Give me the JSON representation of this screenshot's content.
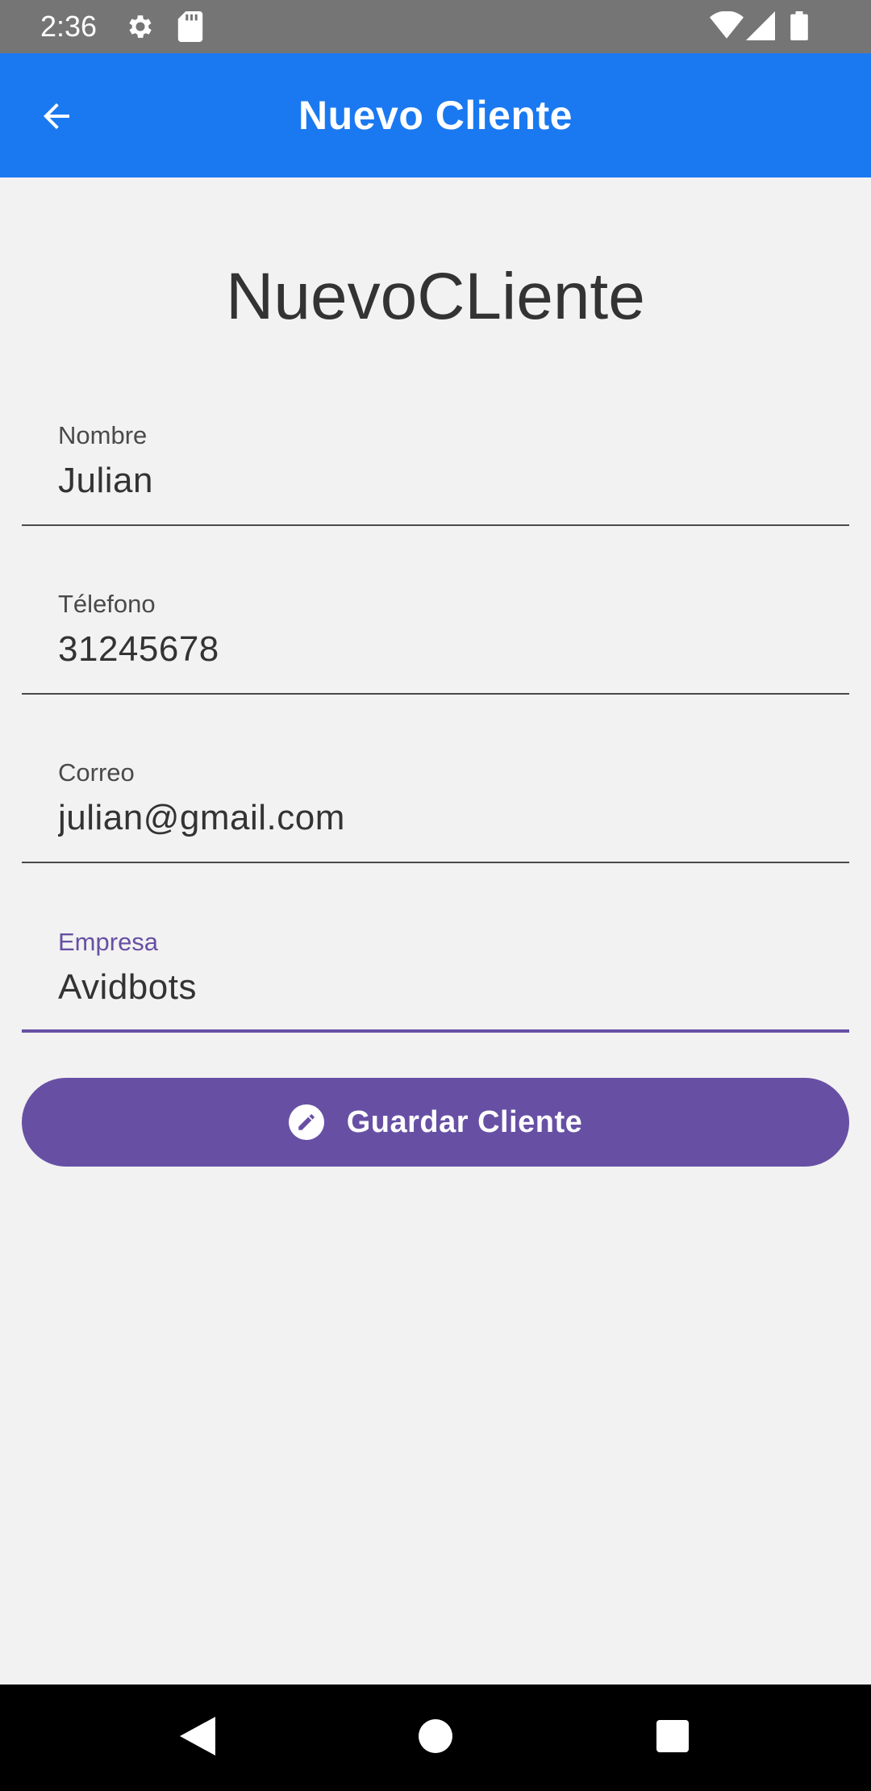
{
  "status_bar": {
    "time": "2:36",
    "icons": [
      "gear-icon",
      "sd-card-icon",
      "wifi-icon",
      "signal-icon",
      "battery-icon"
    ]
  },
  "app_bar": {
    "title": "Nuevo Cliente",
    "back_icon": "arrow-back-icon",
    "color": "#1a79f0"
  },
  "form": {
    "heading": "NuevoCLiente",
    "fields": [
      {
        "label": "Nombre",
        "value": "Julian"
      },
      {
        "label": "Télefono",
        "value": "31245678"
      },
      {
        "label": "Correo",
        "value": "julian@gmail.com"
      },
      {
        "label": "Empresa",
        "value": "Avidbots",
        "focused": true
      }
    ],
    "accent_color": "#6750a4"
  },
  "save_button": {
    "label": "Guardar Cliente",
    "icon": "edit-pencil-icon"
  },
  "nav_bar": {
    "buttons": [
      "back-triangle-icon",
      "home-circle-icon",
      "recents-square-icon"
    ]
  }
}
